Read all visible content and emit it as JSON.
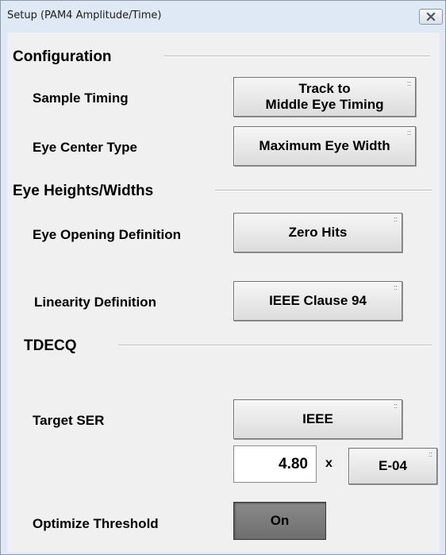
{
  "window": {
    "title": "Setup (PAM4 Amplitude/Time)",
    "close_icon": "close-icon"
  },
  "configuration": {
    "title": "Configuration",
    "sample_timing": {
      "label": "Sample Timing",
      "value_line1": "Track to",
      "value_line2": "Middle Eye Timing"
    },
    "eye_center_type": {
      "label": "Eye Center Type",
      "value": "Maximum Eye Width"
    }
  },
  "eye_heights_widths": {
    "title": "Eye Heights/Widths",
    "eye_opening_definition": {
      "label": "Eye Opening Definition",
      "value": "Zero Hits"
    },
    "linearity_definition": {
      "label": "Linearity Definition",
      "value": "IEEE Clause 94"
    }
  },
  "tdecq": {
    "title": "TDECQ",
    "target_ser": {
      "label": "Target SER",
      "value": "IEEE",
      "mantissa": "4.80",
      "times": "x",
      "exponent": "E-04"
    },
    "optimize_threshold": {
      "label": "Optimize Threshold",
      "value": "On"
    }
  },
  "button_marker": "::"
}
